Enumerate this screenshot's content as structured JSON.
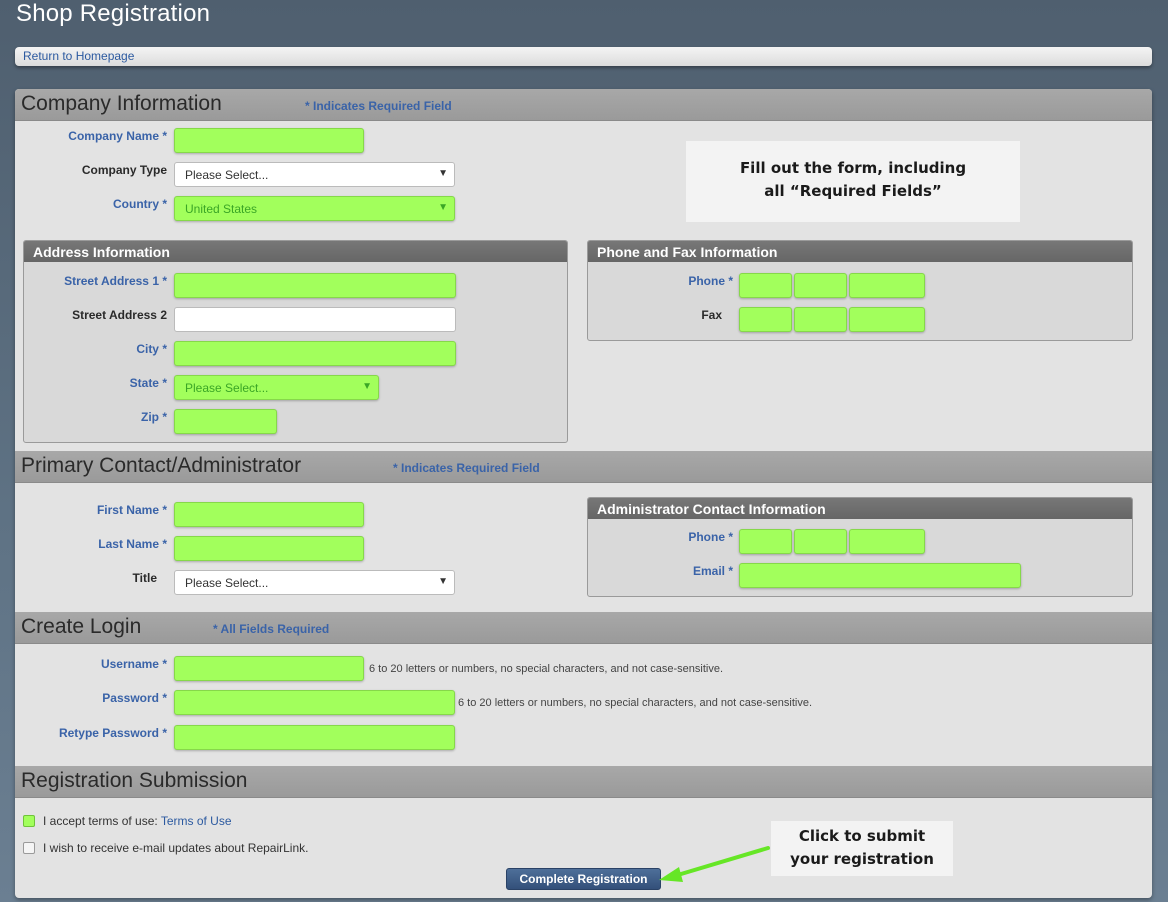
{
  "page": {
    "title": "Shop Registration"
  },
  "nav": {
    "return_link": "Return to Homepage"
  },
  "company": {
    "section_title": "Company Information",
    "required_note": "* Indicates Required Field",
    "company_name_label": "Company Name *",
    "company_type_label": "Company Type",
    "company_type_value": "Please Select...",
    "country_label": "Country *",
    "country_value": "United States",
    "callout_line1": "Fill out the form, including",
    "callout_line2": "all “Required Fields”"
  },
  "address": {
    "header": "Address Information",
    "street1_label": "Street Address 1 *",
    "street2_label": "Street Address 2",
    "city_label": "City *",
    "state_label": "State *",
    "state_value": "Please Select...",
    "zip_label": "Zip *"
  },
  "phone_fax": {
    "header": "Phone and Fax Information",
    "phone_label": "Phone *",
    "fax_label": "Fax"
  },
  "contact": {
    "section_title": "Primary Contact/Administrator",
    "required_note": "* Indicates Required Field",
    "first_name_label": "First Name *",
    "last_name_label": "Last Name *",
    "title_label": "Title",
    "title_value": "Please Select..."
  },
  "admin_contact": {
    "header": "Administrator Contact Information",
    "phone_label": "Phone *",
    "email_label": "Email *"
  },
  "login": {
    "section_title": "Create Login",
    "required_note": "* All Fields Required",
    "username_label": "Username *",
    "username_hint": "6 to 20 letters or numbers, no special characters, and not case-sensitive.",
    "password_label": "Password *",
    "password_hint": "6 to 20 letters or numbers, no special characters, and not case-sensitive.",
    "retype_label": "Retype Password *"
  },
  "submission": {
    "section_title": "Registration Submission",
    "terms_text": "I accept terms of use: ",
    "terms_link": "Terms of Use",
    "terms_checked": true,
    "updates_text": "I wish to receive e-mail updates about RepairLink.",
    "updates_checked": false,
    "submit_label": "Complete Registration",
    "callout_line1": "Click to submit",
    "callout_line2": "your registration"
  },
  "colors": {
    "required_field_fill": "#a2ff5c",
    "label_blue": "#3a63a8",
    "submit_button": "#3b5a86",
    "arrow": "#66e626"
  }
}
